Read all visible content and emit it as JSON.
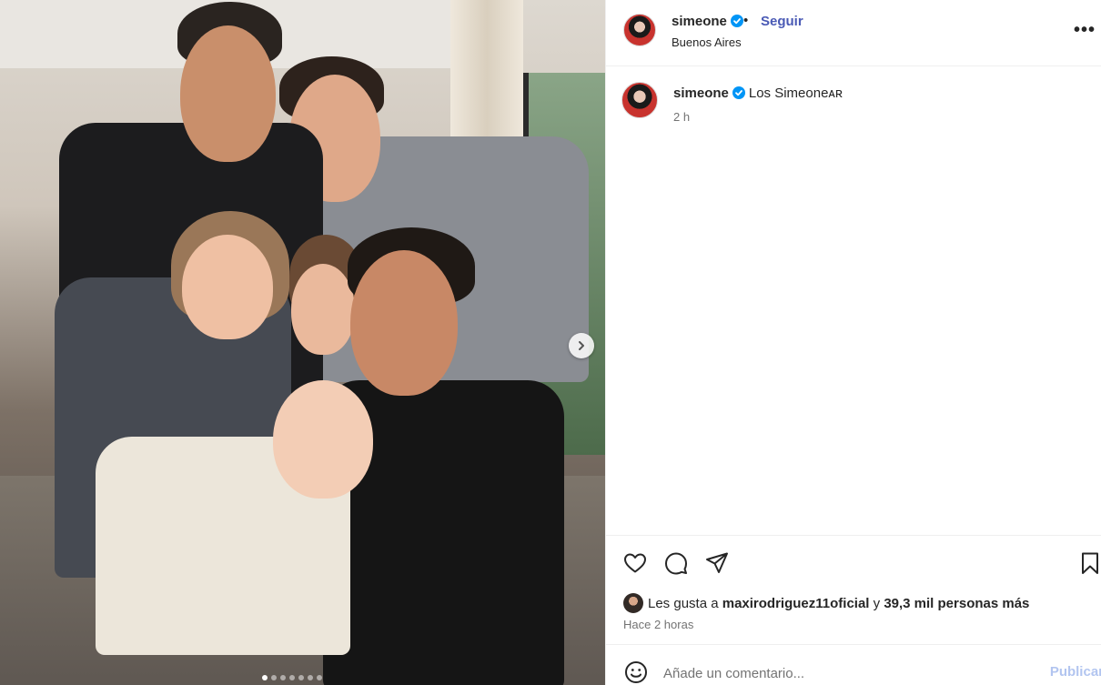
{
  "post": {
    "username": "simeone",
    "location": "Buenos Aires",
    "follow_label": "Seguir",
    "separator": "•",
    "more_label": "•••"
  },
  "caption": {
    "username": "simeone",
    "text": "Los Simeoneᴀʀ",
    "time_ago": "2 h"
  },
  "likes": {
    "prefix": "Les gusta a",
    "liker": "maxirodriguez11oficial",
    "connector": "y",
    "others": "39,3 mil personas más"
  },
  "posted_ago": "Hace 2 horas",
  "comment": {
    "placeholder": "Añade un comentario...",
    "publish_label": "Publicar"
  },
  "carousel": {
    "slide_count": 7,
    "active_index": 0
  },
  "icons": {
    "verified": "verified-badge-icon",
    "like": "heart-icon",
    "comment": "comment-icon",
    "share": "paper-plane-icon",
    "save": "bookmark-icon",
    "emoji": "smiley-icon",
    "next": "chevron-right-icon"
  },
  "colors": {
    "follow": "#4a5ab5",
    "verified": "#0095f6",
    "publish_disabled": "#b2c5f0",
    "muted_text": "#737373"
  }
}
